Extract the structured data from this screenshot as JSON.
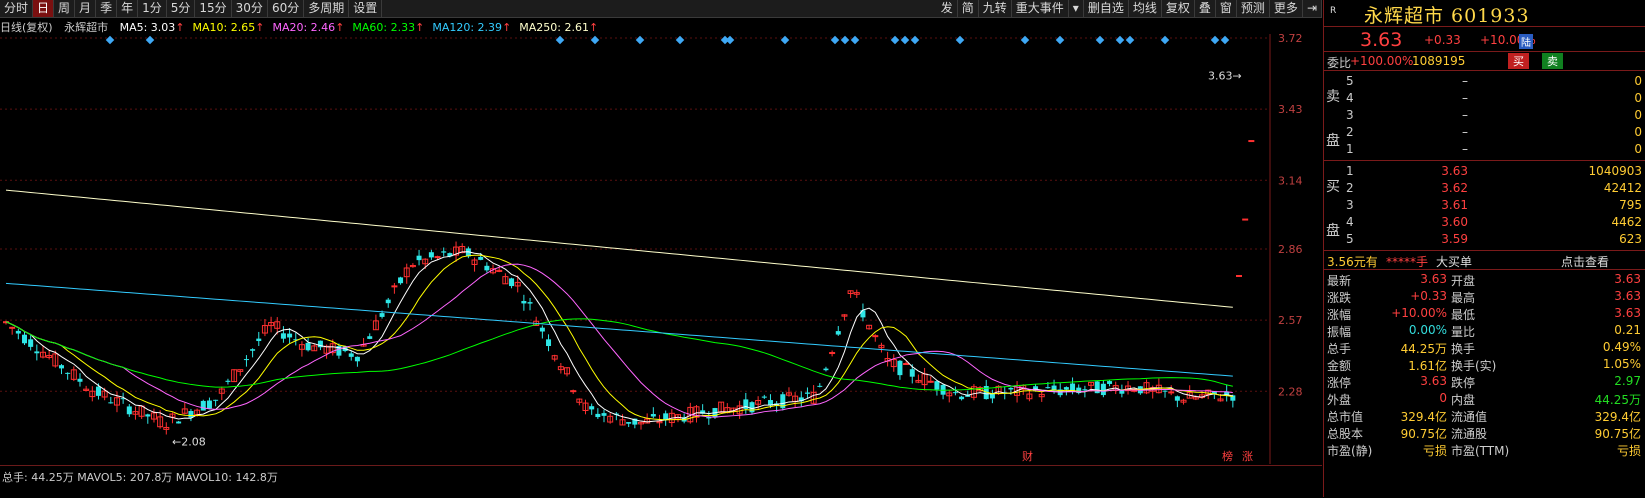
{
  "toolbar": {
    "periods": [
      "分时",
      "日",
      "周",
      "月",
      "季",
      "年",
      "1分",
      "5分",
      "15分",
      "30分",
      "60分",
      "多周期",
      "设置"
    ],
    "active_index": 1,
    "right_items": [
      "发",
      "简",
      "九转",
      "重大事件",
      "▾",
      "删自选",
      "均线",
      "复权",
      "叠",
      "窗",
      "预测",
      "更多"
    ]
  },
  "ma": {
    "title": "日线(复权)",
    "name": "永辉超市",
    "items": [
      {
        "label": "MA5: 3.03",
        "color": "#ffffff"
      },
      {
        "label": "MA10: 2.65",
        "color": "#ffff00"
      },
      {
        "label": "MA20: 2.46",
        "color": "#ff66ff"
      },
      {
        "label": "MA60: 2.33",
        "color": "#00ff00"
      },
      {
        "label": "MA120: 2.39",
        "color": "#33ccff"
      },
      {
        "label": "MA250: 2.61",
        "color": "#ffffcc"
      }
    ]
  },
  "axis": {
    "ticks": [
      "3.72",
      "3.43",
      "3.14",
      "2.86",
      "2.57",
      "2.28"
    ],
    "last_price_tag": "3.63",
    "low_label": "2.08",
    "markers": [
      "财",
      "榜",
      "涨"
    ]
  },
  "chart_data": {
    "type": "candlestick",
    "ylim": [
      2.0,
      3.72
    ],
    "last": 3.63,
    "low": 2.08
  },
  "quote": {
    "badge": "R",
    "title": "永辉超市 601933",
    "price": "3.63",
    "change": "+0.33",
    "pct": "+10.00%",
    "tag": "陆"
  },
  "weibi": {
    "label": "委比",
    "ratio": "+100.00%",
    "vol": "1089195",
    "buy_btn": "买",
    "sell_btn": "卖"
  },
  "sell_book": {
    "side": "卖盘",
    "rows": [
      {
        "lv": "5",
        "pr": "–",
        "vol": "0"
      },
      {
        "lv": "4",
        "pr": "–",
        "vol": "0"
      },
      {
        "lv": "3",
        "pr": "–",
        "vol": "0"
      },
      {
        "lv": "2",
        "pr": "–",
        "vol": "0"
      },
      {
        "lv": "1",
        "pr": "–",
        "vol": "0"
      }
    ]
  },
  "buy_book": {
    "side": "买盘",
    "rows": [
      {
        "lv": "1",
        "pr": "3.63",
        "vol": "1040903"
      },
      {
        "lv": "2",
        "pr": "3.62",
        "vol": "42412"
      },
      {
        "lv": "3",
        "pr": "3.61",
        "vol": "795"
      },
      {
        "lv": "4",
        "pr": "3.60",
        "vol": "4462"
      },
      {
        "lv": "5",
        "pr": "3.59",
        "vol": "623"
      }
    ]
  },
  "bigorder": {
    "left": "3.56元有",
    "mid": "*****手",
    "big": "大买单",
    "right": "点击查看"
  },
  "stats": [
    {
      "k1": "最新",
      "v1": "3.63",
      "c1": "red",
      "k2": "开盘",
      "v2": "3.63",
      "c2": "red"
    },
    {
      "k1": "涨跌",
      "v1": "+0.33",
      "c1": "red",
      "k2": "最高",
      "v2": "3.63",
      "c2": "red"
    },
    {
      "k1": "涨幅",
      "v1": "+10.00%",
      "c1": "red",
      "k2": "最低",
      "v2": "3.63",
      "c2": "red"
    },
    {
      "k1": "振幅",
      "v1": "0.00%",
      "c1": "cyan",
      "k2": "量比",
      "v2": "0.21",
      "c2": "yel"
    },
    {
      "k1": "总手",
      "v1": "44.25万",
      "c1": "yel",
      "k2": "换手",
      "v2": "0.49%",
      "c2": "yel"
    },
    {
      "k1": "金额",
      "v1": "1.61亿",
      "c1": "yel",
      "k2": "换手(实)",
      "v2": "1.05%",
      "c2": "yel"
    },
    {
      "k1": "涨停",
      "v1": "3.63",
      "c1": "red",
      "k2": "跌停",
      "v2": "2.97",
      "c2": "grn"
    },
    {
      "k1": "外盘",
      "v1": "0",
      "c1": "red",
      "k2": "内盘",
      "v2": "44.25万",
      "c2": "grn"
    },
    {
      "k1": "总市值",
      "v1": "329.4亿",
      "c1": "yel",
      "k2": "流通值",
      "v2": "329.4亿",
      "c2": "yel"
    },
    {
      "k1": "总股本",
      "v1": "90.75亿",
      "c1": "yel",
      "k2": "流通股",
      "v2": "90.75亿",
      "c2": "yel"
    },
    {
      "k1": "市盈(静)",
      "v1": "亏损",
      "c1": "yel",
      "k2": "市盈(TTM)",
      "v2": "亏损",
      "c2": "yel"
    }
  ],
  "bottom": {
    "text": "总手: 44.25万  MAVOL5: 207.8万  MAVOL10: 142.8万"
  }
}
